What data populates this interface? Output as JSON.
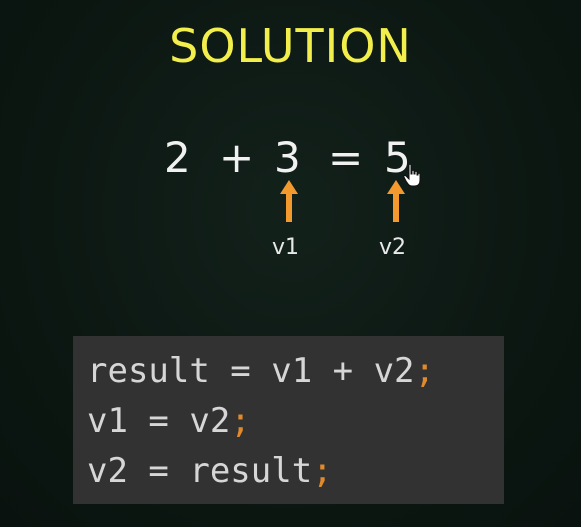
{
  "title": "SOLUTION",
  "equation": {
    "operand_a": "2",
    "plus": "+",
    "operand_b": "3",
    "equals": "=",
    "result": "5"
  },
  "annotations": {
    "v1_label": "v1",
    "v2_label": "v2",
    "arrow_color": "#f29a2e"
  },
  "code": {
    "lines": [
      {
        "text": "result = v1 + v2",
        "terminator": ";"
      },
      {
        "text": "v1 = v2",
        "terminator": ";"
      },
      {
        "text": "v2 = result",
        "terminator": ";"
      }
    ],
    "terminator_color": "#e08a2c",
    "background": "#323232"
  },
  "colors": {
    "title": "#f2ee4b",
    "background": "#0c1712",
    "text": "#f1f1f1"
  }
}
